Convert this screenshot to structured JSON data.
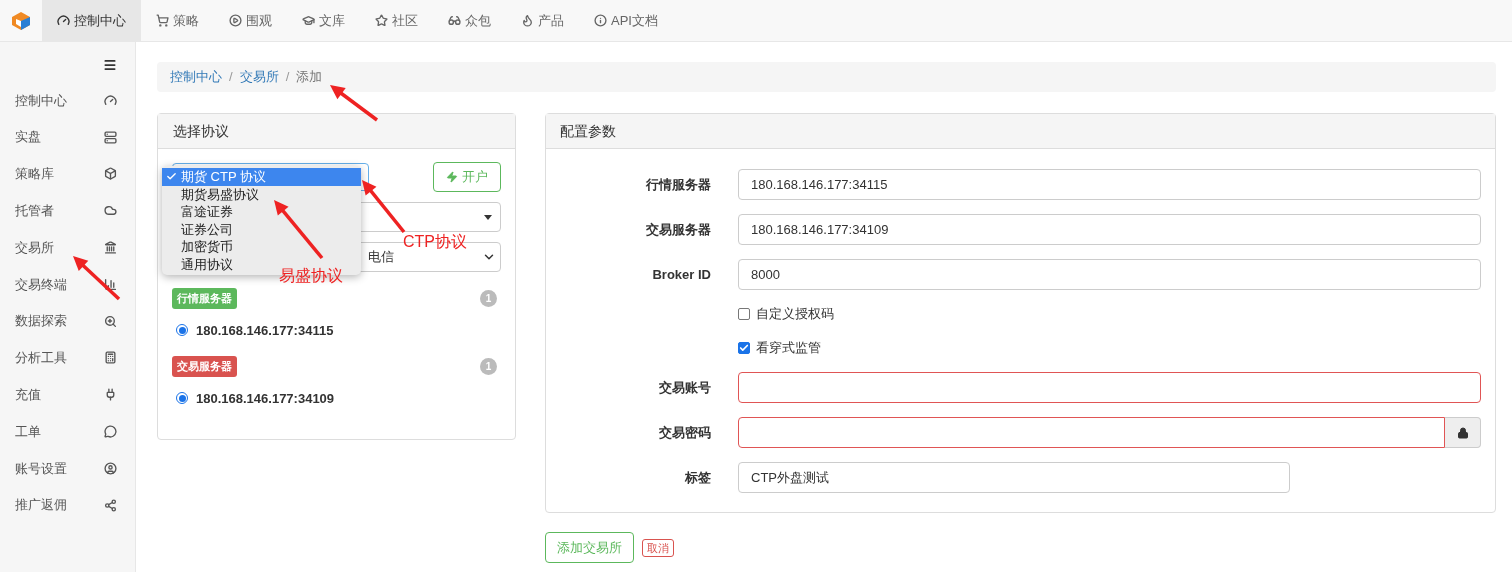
{
  "nav": {
    "items": [
      {
        "label": "控制中心",
        "selected": true
      },
      {
        "label": "策略",
        "selected": false
      },
      {
        "label": "围观",
        "selected": false
      },
      {
        "label": "文库",
        "selected": false
      },
      {
        "label": "社区",
        "selected": false
      },
      {
        "label": "众包",
        "selected": false
      },
      {
        "label": "产品",
        "selected": false
      },
      {
        "label": "API文档",
        "selected": false
      }
    ]
  },
  "sidebar": {
    "items": [
      {
        "label": "控制中心"
      },
      {
        "label": "实盘"
      },
      {
        "label": "策略库"
      },
      {
        "label": "托管者"
      },
      {
        "label": "交易所"
      },
      {
        "label": "交易终端"
      },
      {
        "label": "数据探索"
      },
      {
        "label": "分析工具"
      },
      {
        "label": "充值"
      },
      {
        "label": "工单"
      },
      {
        "label": "账号设置"
      },
      {
        "label": "推广返佣"
      }
    ]
  },
  "breadcrumb": [
    {
      "label": "控制中心",
      "link": true
    },
    {
      "separator": "/",
      "label": "交易所",
      "link": true
    },
    {
      "separator": "/",
      "label": "添加",
      "link": false
    }
  ],
  "protocol_panel": {
    "title": "选择协议",
    "open_account_button": "开户",
    "dropdown": {
      "options": [
        {
          "label": "期货 CTP 协议",
          "selected": true
        },
        {
          "label": "期货易盛协议",
          "selected": false
        },
        {
          "label": "富途证券",
          "selected": false
        },
        {
          "label": "证券公司",
          "selected": false
        },
        {
          "label": "加密货币",
          "selected": false
        },
        {
          "label": "通用协议",
          "selected": false
        }
      ]
    },
    "line_select": {
      "value": "电信"
    },
    "server_groups": [
      {
        "badge": "行情服务器",
        "color": "#5cb85c",
        "count": "1",
        "servers": [
          {
            "address": "180.168.146.177:34115",
            "selected": true
          }
        ]
      },
      {
        "badge": "交易服务器",
        "color": "#d9534f",
        "count": "1",
        "servers": [
          {
            "address": "180.168.146.177:34109",
            "selected": true
          }
        ]
      }
    ]
  },
  "config_panel": {
    "title": "配置参数",
    "fields": [
      {
        "kind": "input",
        "label": "行情服务器",
        "value": "180.168.146.177:34115",
        "invalid": false
      },
      {
        "kind": "input",
        "label": "交易服务器",
        "value": "180.168.146.177:34109",
        "invalid": false
      },
      {
        "kind": "input",
        "label": "Broker ID",
        "value": "8000",
        "invalid": false
      },
      {
        "kind": "checkbox",
        "label": "自定义授权码",
        "checked": false
      },
      {
        "kind": "checkbox",
        "label": "看穿式监管",
        "checked": true
      },
      {
        "kind": "input",
        "label": "交易账号",
        "invalid": true
      },
      {
        "kind": "password",
        "label": "交易密码",
        "invalid": true
      },
      {
        "kind": "short",
        "label": "标签",
        "value": "CTP外盘测试",
        "invalid": false
      }
    ]
  },
  "actions": {
    "submit": "添加交易所",
    "cancel": "取消"
  },
  "annotations": [
    {
      "text": "CTP协议"
    },
    {
      "text": "易盛协议"
    }
  ]
}
